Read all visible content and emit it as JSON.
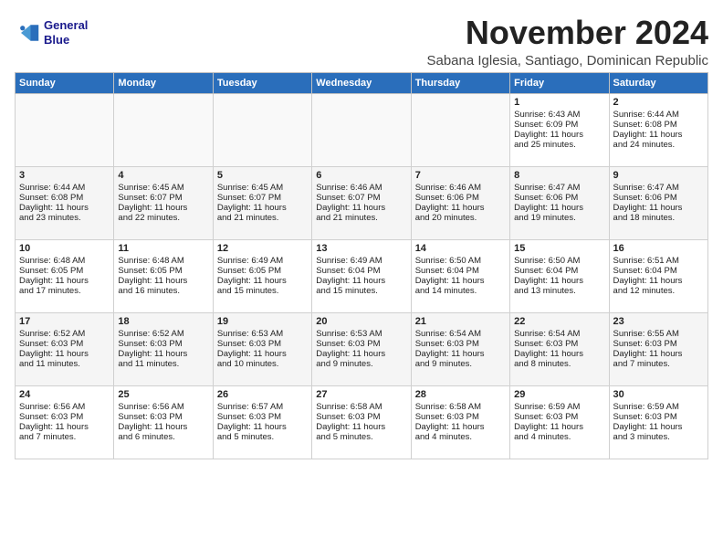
{
  "header": {
    "logo_line1": "General",
    "logo_line2": "Blue",
    "month_title": "November 2024",
    "subtitle": "Sabana Iglesia, Santiago, Dominican Republic"
  },
  "weekdays": [
    "Sunday",
    "Monday",
    "Tuesday",
    "Wednesday",
    "Thursday",
    "Friday",
    "Saturday"
  ],
  "weeks": [
    [
      {
        "day": "",
        "info": ""
      },
      {
        "day": "",
        "info": ""
      },
      {
        "day": "",
        "info": ""
      },
      {
        "day": "",
        "info": ""
      },
      {
        "day": "",
        "info": ""
      },
      {
        "day": "1",
        "info": "Sunrise: 6:43 AM\nSunset: 6:09 PM\nDaylight: 11 hours\nand 25 minutes."
      },
      {
        "day": "2",
        "info": "Sunrise: 6:44 AM\nSunset: 6:08 PM\nDaylight: 11 hours\nand 24 minutes."
      }
    ],
    [
      {
        "day": "3",
        "info": "Sunrise: 6:44 AM\nSunset: 6:08 PM\nDaylight: 11 hours\nand 23 minutes."
      },
      {
        "day": "4",
        "info": "Sunrise: 6:45 AM\nSunset: 6:07 PM\nDaylight: 11 hours\nand 22 minutes."
      },
      {
        "day": "5",
        "info": "Sunrise: 6:45 AM\nSunset: 6:07 PM\nDaylight: 11 hours\nand 21 minutes."
      },
      {
        "day": "6",
        "info": "Sunrise: 6:46 AM\nSunset: 6:07 PM\nDaylight: 11 hours\nand 21 minutes."
      },
      {
        "day": "7",
        "info": "Sunrise: 6:46 AM\nSunset: 6:06 PM\nDaylight: 11 hours\nand 20 minutes."
      },
      {
        "day": "8",
        "info": "Sunrise: 6:47 AM\nSunset: 6:06 PM\nDaylight: 11 hours\nand 19 minutes."
      },
      {
        "day": "9",
        "info": "Sunrise: 6:47 AM\nSunset: 6:06 PM\nDaylight: 11 hours\nand 18 minutes."
      }
    ],
    [
      {
        "day": "10",
        "info": "Sunrise: 6:48 AM\nSunset: 6:05 PM\nDaylight: 11 hours\nand 17 minutes."
      },
      {
        "day": "11",
        "info": "Sunrise: 6:48 AM\nSunset: 6:05 PM\nDaylight: 11 hours\nand 16 minutes."
      },
      {
        "day": "12",
        "info": "Sunrise: 6:49 AM\nSunset: 6:05 PM\nDaylight: 11 hours\nand 15 minutes."
      },
      {
        "day": "13",
        "info": "Sunrise: 6:49 AM\nSunset: 6:04 PM\nDaylight: 11 hours\nand 15 minutes."
      },
      {
        "day": "14",
        "info": "Sunrise: 6:50 AM\nSunset: 6:04 PM\nDaylight: 11 hours\nand 14 minutes."
      },
      {
        "day": "15",
        "info": "Sunrise: 6:50 AM\nSunset: 6:04 PM\nDaylight: 11 hours\nand 13 minutes."
      },
      {
        "day": "16",
        "info": "Sunrise: 6:51 AM\nSunset: 6:04 PM\nDaylight: 11 hours\nand 12 minutes."
      }
    ],
    [
      {
        "day": "17",
        "info": "Sunrise: 6:52 AM\nSunset: 6:03 PM\nDaylight: 11 hours\nand 11 minutes."
      },
      {
        "day": "18",
        "info": "Sunrise: 6:52 AM\nSunset: 6:03 PM\nDaylight: 11 hours\nand 11 minutes."
      },
      {
        "day": "19",
        "info": "Sunrise: 6:53 AM\nSunset: 6:03 PM\nDaylight: 11 hours\nand 10 minutes."
      },
      {
        "day": "20",
        "info": "Sunrise: 6:53 AM\nSunset: 6:03 PM\nDaylight: 11 hours\nand 9 minutes."
      },
      {
        "day": "21",
        "info": "Sunrise: 6:54 AM\nSunset: 6:03 PM\nDaylight: 11 hours\nand 9 minutes."
      },
      {
        "day": "22",
        "info": "Sunrise: 6:54 AM\nSunset: 6:03 PM\nDaylight: 11 hours\nand 8 minutes."
      },
      {
        "day": "23",
        "info": "Sunrise: 6:55 AM\nSunset: 6:03 PM\nDaylight: 11 hours\nand 7 minutes."
      }
    ],
    [
      {
        "day": "24",
        "info": "Sunrise: 6:56 AM\nSunset: 6:03 PM\nDaylight: 11 hours\nand 7 minutes."
      },
      {
        "day": "25",
        "info": "Sunrise: 6:56 AM\nSunset: 6:03 PM\nDaylight: 11 hours\nand 6 minutes."
      },
      {
        "day": "26",
        "info": "Sunrise: 6:57 AM\nSunset: 6:03 PM\nDaylight: 11 hours\nand 5 minutes."
      },
      {
        "day": "27",
        "info": "Sunrise: 6:58 AM\nSunset: 6:03 PM\nDaylight: 11 hours\nand 5 minutes."
      },
      {
        "day": "28",
        "info": "Sunrise: 6:58 AM\nSunset: 6:03 PM\nDaylight: 11 hours\nand 4 minutes."
      },
      {
        "day": "29",
        "info": "Sunrise: 6:59 AM\nSunset: 6:03 PM\nDaylight: 11 hours\nand 4 minutes."
      },
      {
        "day": "30",
        "info": "Sunrise: 6:59 AM\nSunset: 6:03 PM\nDaylight: 11 hours\nand 3 minutes."
      }
    ]
  ]
}
